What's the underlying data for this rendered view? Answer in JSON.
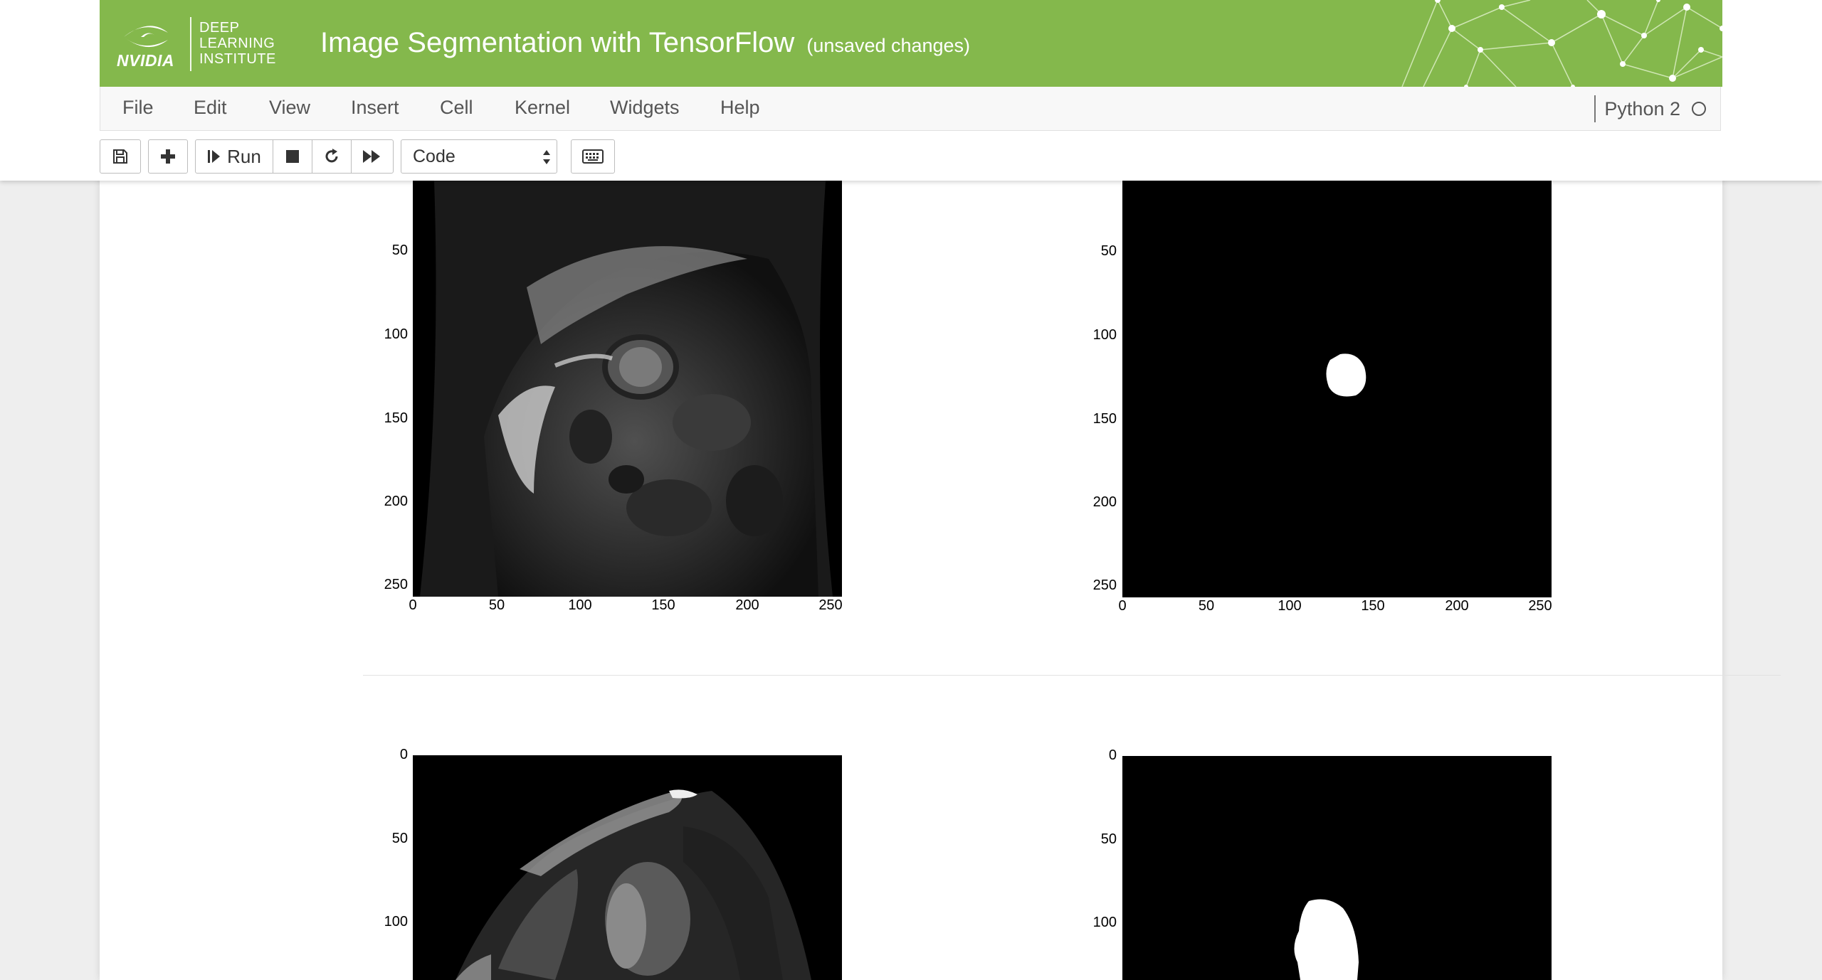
{
  "header": {
    "brand": "NVIDIA",
    "dli_lines": [
      "DEEP",
      "LEARNING",
      "INSTITUTE"
    ],
    "title": "Image Segmentation with TensorFlow",
    "status": "(unsaved changes)"
  },
  "menu": {
    "items": [
      "File",
      "Edit",
      "View",
      "Insert",
      "Cell",
      "Kernel",
      "Widgets",
      "Help"
    ],
    "kernel_name": "Python 2"
  },
  "toolbar": {
    "run_label": "Run",
    "cell_type": "Code",
    "buttons": [
      "save-icon",
      "plus-icon",
      "step-forward-icon",
      "stop-icon",
      "refresh-icon",
      "fast-forward-icon",
      "keyboard-icon"
    ]
  },
  "plots": {
    "row1": {
      "yticks": [
        "50",
        "100",
        "150",
        "200",
        "250"
      ],
      "xticks": [
        "0",
        "50",
        "100",
        "150",
        "200",
        "250"
      ]
    },
    "row2": {
      "yticks": [
        "0",
        "50",
        "100"
      ]
    },
    "colors": {
      "header_green": "#84b84c",
      "mask_white": "#ffffff",
      "background_black": "#000000"
    }
  }
}
